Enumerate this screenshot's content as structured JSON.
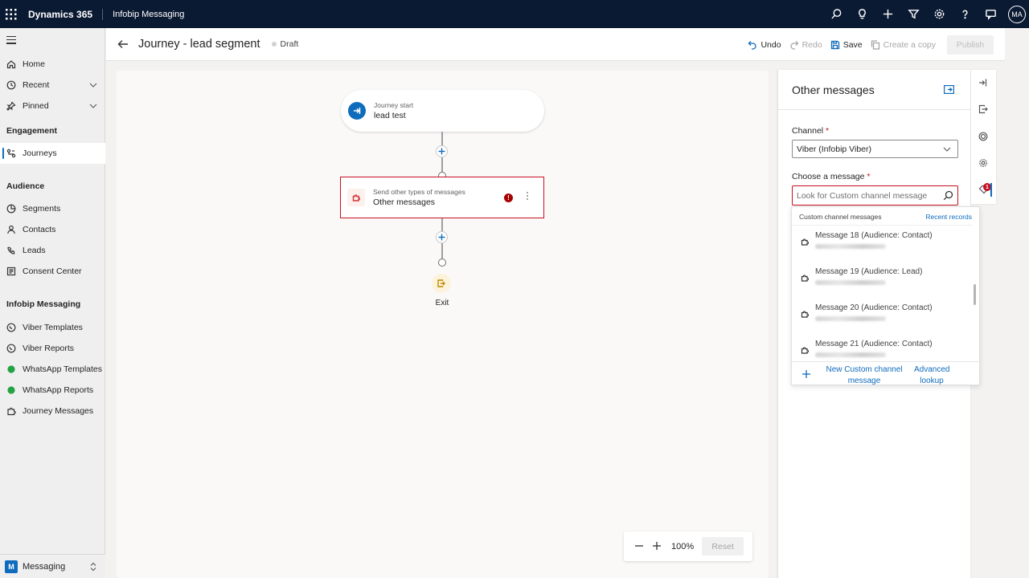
{
  "topbar": {
    "brand": "Dynamics 365",
    "app_name": "Infobip Messaging",
    "icons": [
      "search-icon",
      "lightbulb-icon",
      "plus-icon",
      "filter-icon",
      "settings-icon",
      "help-icon",
      "chat-icon"
    ],
    "user_initials": "MA"
  },
  "sidebar": {
    "top_items": [
      {
        "label": "Home",
        "icon": "home-icon"
      },
      {
        "label": "Recent",
        "icon": "clock-icon"
      },
      {
        "label": "Pinned",
        "icon": "pin-icon"
      }
    ],
    "sections": [
      {
        "heading": "Engagement",
        "items": [
          {
            "label": "Journeys",
            "icon": "journey-icon",
            "active": true
          }
        ]
      },
      {
        "heading": "Audience",
        "items": [
          {
            "label": "Segments",
            "icon": "segments-icon"
          },
          {
            "label": "Contacts",
            "icon": "person-icon"
          },
          {
            "label": "Leads",
            "icon": "leads-icon"
          },
          {
            "label": "Consent Center",
            "icon": "consent-icon"
          }
        ]
      },
      {
        "heading": "Infobip Messaging",
        "items": [
          {
            "label": "Viber Templates",
            "icon": "viber-icon"
          },
          {
            "label": "Viber Reports",
            "icon": "viber-icon"
          },
          {
            "label": "WhatsApp Templates",
            "icon": "whatsapp-icon"
          },
          {
            "label": "WhatsApp Reports",
            "icon": "whatsapp-icon"
          },
          {
            "label": "Journey Messages",
            "icon": "puzzle-icon"
          }
        ]
      }
    ],
    "area": {
      "badge": "M",
      "label": "Messaging"
    }
  },
  "header": {
    "title": "Journey - lead segment",
    "status": "Draft",
    "undo": "Undo",
    "redo": "Redo",
    "save": "Save",
    "copy": "Create a copy",
    "publish": "Publish"
  },
  "canvas": {
    "start_node": {
      "subtitle": "Journey start",
      "title": "lead test"
    },
    "message_node": {
      "subtitle": "Send other types of messages",
      "title": "Other messages",
      "error": "!"
    },
    "exit_label": "Exit",
    "zoom": "100%",
    "reset": "Reset"
  },
  "panel": {
    "title": "Other messages",
    "channel_label": "Channel",
    "channel_value": "Viber (Infobip Viber)",
    "message_label": "Choose a message",
    "required_mark": "*",
    "search_placeholder": "Look for Custom channel message",
    "flyout": {
      "heading": "Custom channel messages",
      "recent": "Recent records",
      "items": [
        {
          "label": "Message 18 (Audience: Contact)"
        },
        {
          "label": "Message 19 (Audience: Lead)"
        },
        {
          "label": "Message 20 (Audience: Contact)"
        },
        {
          "label": "Message 21 (Audience: Contact)"
        }
      ],
      "new_label": "New Custom channel message",
      "advanced_label": "Advanced lookup"
    },
    "rail_badge": "1"
  }
}
